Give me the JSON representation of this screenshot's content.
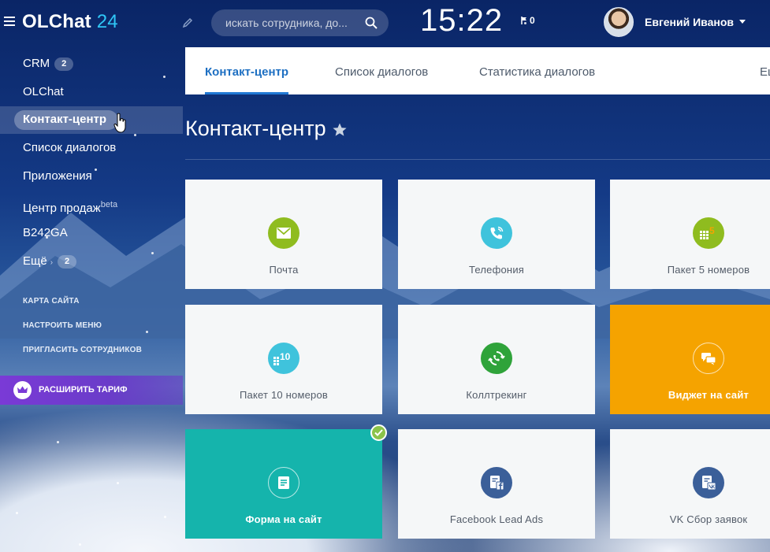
{
  "app": {
    "logo_text": "OLChat",
    "logo_number": "24",
    "clock": "15:22",
    "flag_count": "0",
    "user_name": "Евгений Иванов"
  },
  "search": {
    "placeholder": "искать сотрудника, до..."
  },
  "sidebar": {
    "items": [
      {
        "label": "CRM",
        "badge": "2"
      },
      {
        "label": "OLChat"
      },
      {
        "label": "Контакт-центр",
        "active": true
      },
      {
        "label": "Список диалогов"
      },
      {
        "label": "Приложения"
      },
      {
        "label": "Центр продаж",
        "sup": "beta"
      },
      {
        "label": "B242GA"
      },
      {
        "label": "Ещё",
        "badge": "2"
      }
    ],
    "links": [
      {
        "label": "КАРТА САЙТА"
      },
      {
        "label": "НАСТРОИТЬ МЕНЮ"
      },
      {
        "label": "ПРИГЛАСИТЬ СОТРУДНИКОВ"
      }
    ],
    "upgrade_label": "РАСШИРИТЬ ТАРИФ"
  },
  "tabs": [
    {
      "label": "Контакт-центр",
      "active": true
    },
    {
      "label": "Список диалогов"
    },
    {
      "label": "Статистика диалогов"
    },
    {
      "label": "Ещ"
    }
  ],
  "page": {
    "title": "Контакт-центр"
  },
  "tiles": [
    {
      "label": "Почта",
      "icon": "mail-icon",
      "color": "#8fbc1f"
    },
    {
      "label": "Телефония",
      "icon": "phone-icon",
      "color": "#3fc3dc"
    },
    {
      "label": "Пакет 5 номеров",
      "icon": "dialpad-5-icon",
      "icon_text": "5",
      "color": "#8fbc1f"
    },
    {
      "label": "Пакет 10 номеров",
      "icon": "dialpad-10-icon",
      "icon_text": "10",
      "color": "#3fc3dc"
    },
    {
      "label": "Коллтрекинг",
      "icon": "calltracking-icon",
      "color": "#2fa33a"
    },
    {
      "label": "Виджет на сайт",
      "icon": "chat-bubbles-icon",
      "color": "#f5a300"
    },
    {
      "label": "Форма на сайт",
      "icon": "form-icon",
      "color": "#15b4ac",
      "connected": true
    },
    {
      "label": "Facebook Lead Ads",
      "icon": "facebook-form-icon",
      "color": "#3b5f99"
    },
    {
      "label": "VK Сбор заявок",
      "icon": "vk-form-icon",
      "color": "#3b5f99"
    }
  ],
  "colors": {
    "accent": "#2fc6f6",
    "tab_active": "#2078d4",
    "upgrade": "#7a3ad6",
    "check": "#8bc34a"
  }
}
